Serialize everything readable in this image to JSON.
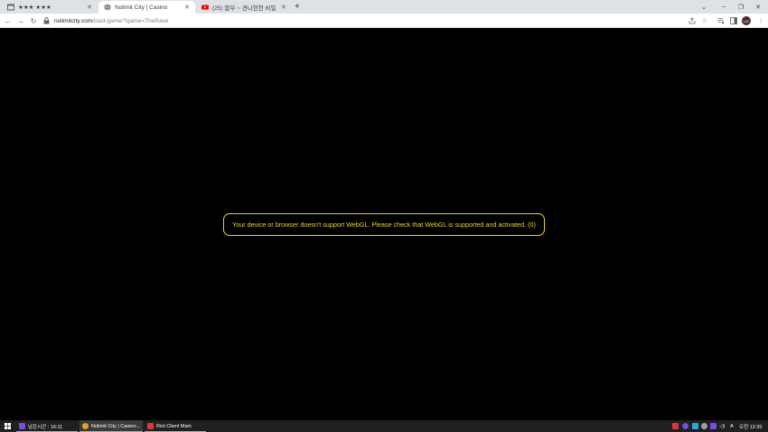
{
  "tabs": [
    {
      "title": "★★★ ★★★",
      "icon": "window-icon"
    },
    {
      "title": "Nolimit City | Casino",
      "icon": "globe-icon"
    },
    {
      "title": "(25) 합부 ~ 견나현현 비밀 | - Y",
      "icon": "youtube-icon"
    }
  ],
  "newtab_label": "+",
  "window_controls": {
    "minimize": "–",
    "restore": "❐",
    "close": "✕",
    "tabsearch": "⌄"
  },
  "toolbar": {
    "back": "←",
    "forward": "→",
    "reload": "↻",
    "url_host": "nolimitcity.com",
    "url_path": "/load-game/?game=TheRave",
    "avatar_initials": "US"
  },
  "content": {
    "webgl_message": "Your device or browser doesn't support WebGL. Please check that WebGL is supported and activated. (0)"
  },
  "taskbar": {
    "start": "⊞",
    "items": [
      {
        "label": "남은시간 : 16:11",
        "color": "#7b4de0"
      },
      {
        "label": "Nolimit City | Casino...",
        "color": "#e5a125"
      },
      {
        "label": "Riot Client Main",
        "color": "#e0343b"
      }
    ],
    "tray": {
      "ime": "A",
      "volume": "◁)",
      "time": "오전 12:35"
    }
  },
  "colors": {
    "accent": "#e8d22c",
    "background": "#000000"
  }
}
